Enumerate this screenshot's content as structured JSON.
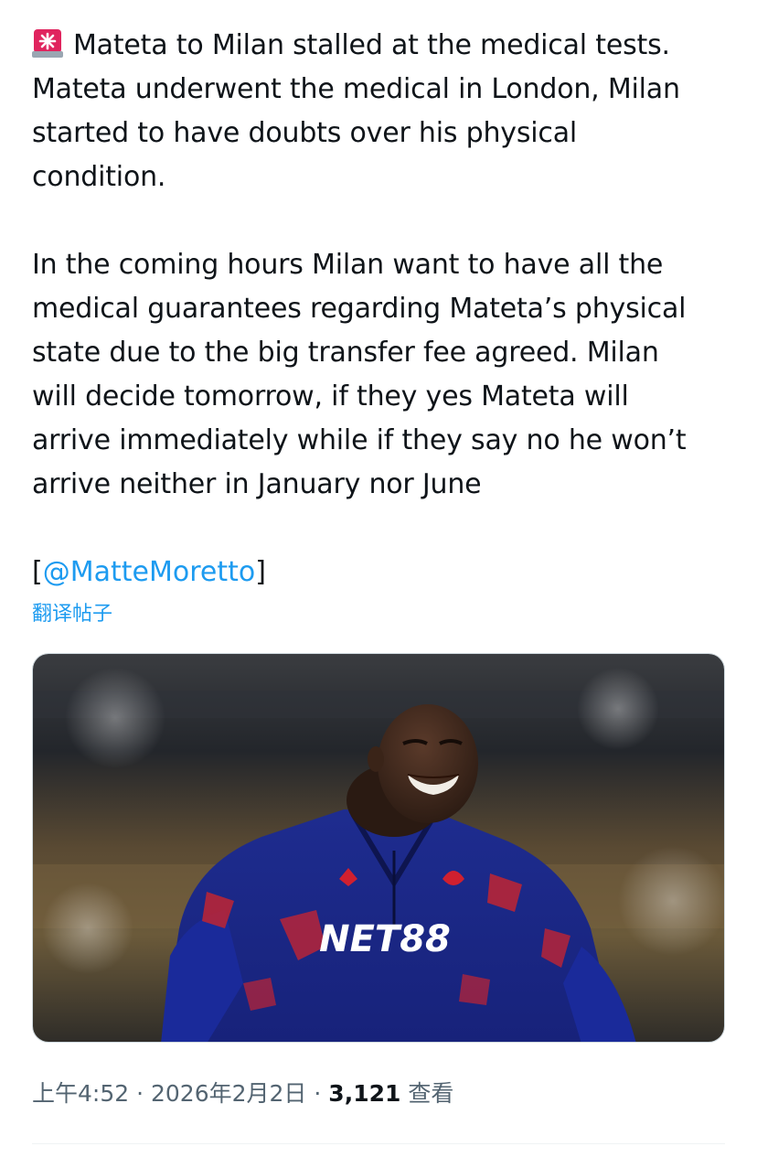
{
  "tweet": {
    "alert_icon": "siren-icon",
    "paragraph1": [
      "Mateta to Milan stalled at the medical tests.",
      "Mateta underwent the medical in London, Milan",
      "started to have doubts over his physical",
      "condition."
    ],
    "paragraph2": [
      "In the coming hours Milan want to have all the",
      "medical guarantees regarding Mateta’s physical",
      "state due to the big transfer fee agreed. Milan",
      "will decide tomorrow, if they yes Mateta will",
      "arrive immediately while if they say no he won’t",
      "arrive neither in January nor June"
    ],
    "mention_open": "[",
    "mention": "@MatteMoretto",
    "mention_close": "]",
    "translate_label": "翻译帖子",
    "image": {
      "sponsor_text": "NET88"
    },
    "meta": {
      "time": "上午4:52",
      "separator": "·",
      "date": "2026年2月2日",
      "views_count": "3,121",
      "views_label": "查看"
    }
  },
  "colors": {
    "link": "#1d9bf0",
    "text": "#0f1419",
    "muted": "#536471",
    "siren_red": "#e0245e"
  }
}
